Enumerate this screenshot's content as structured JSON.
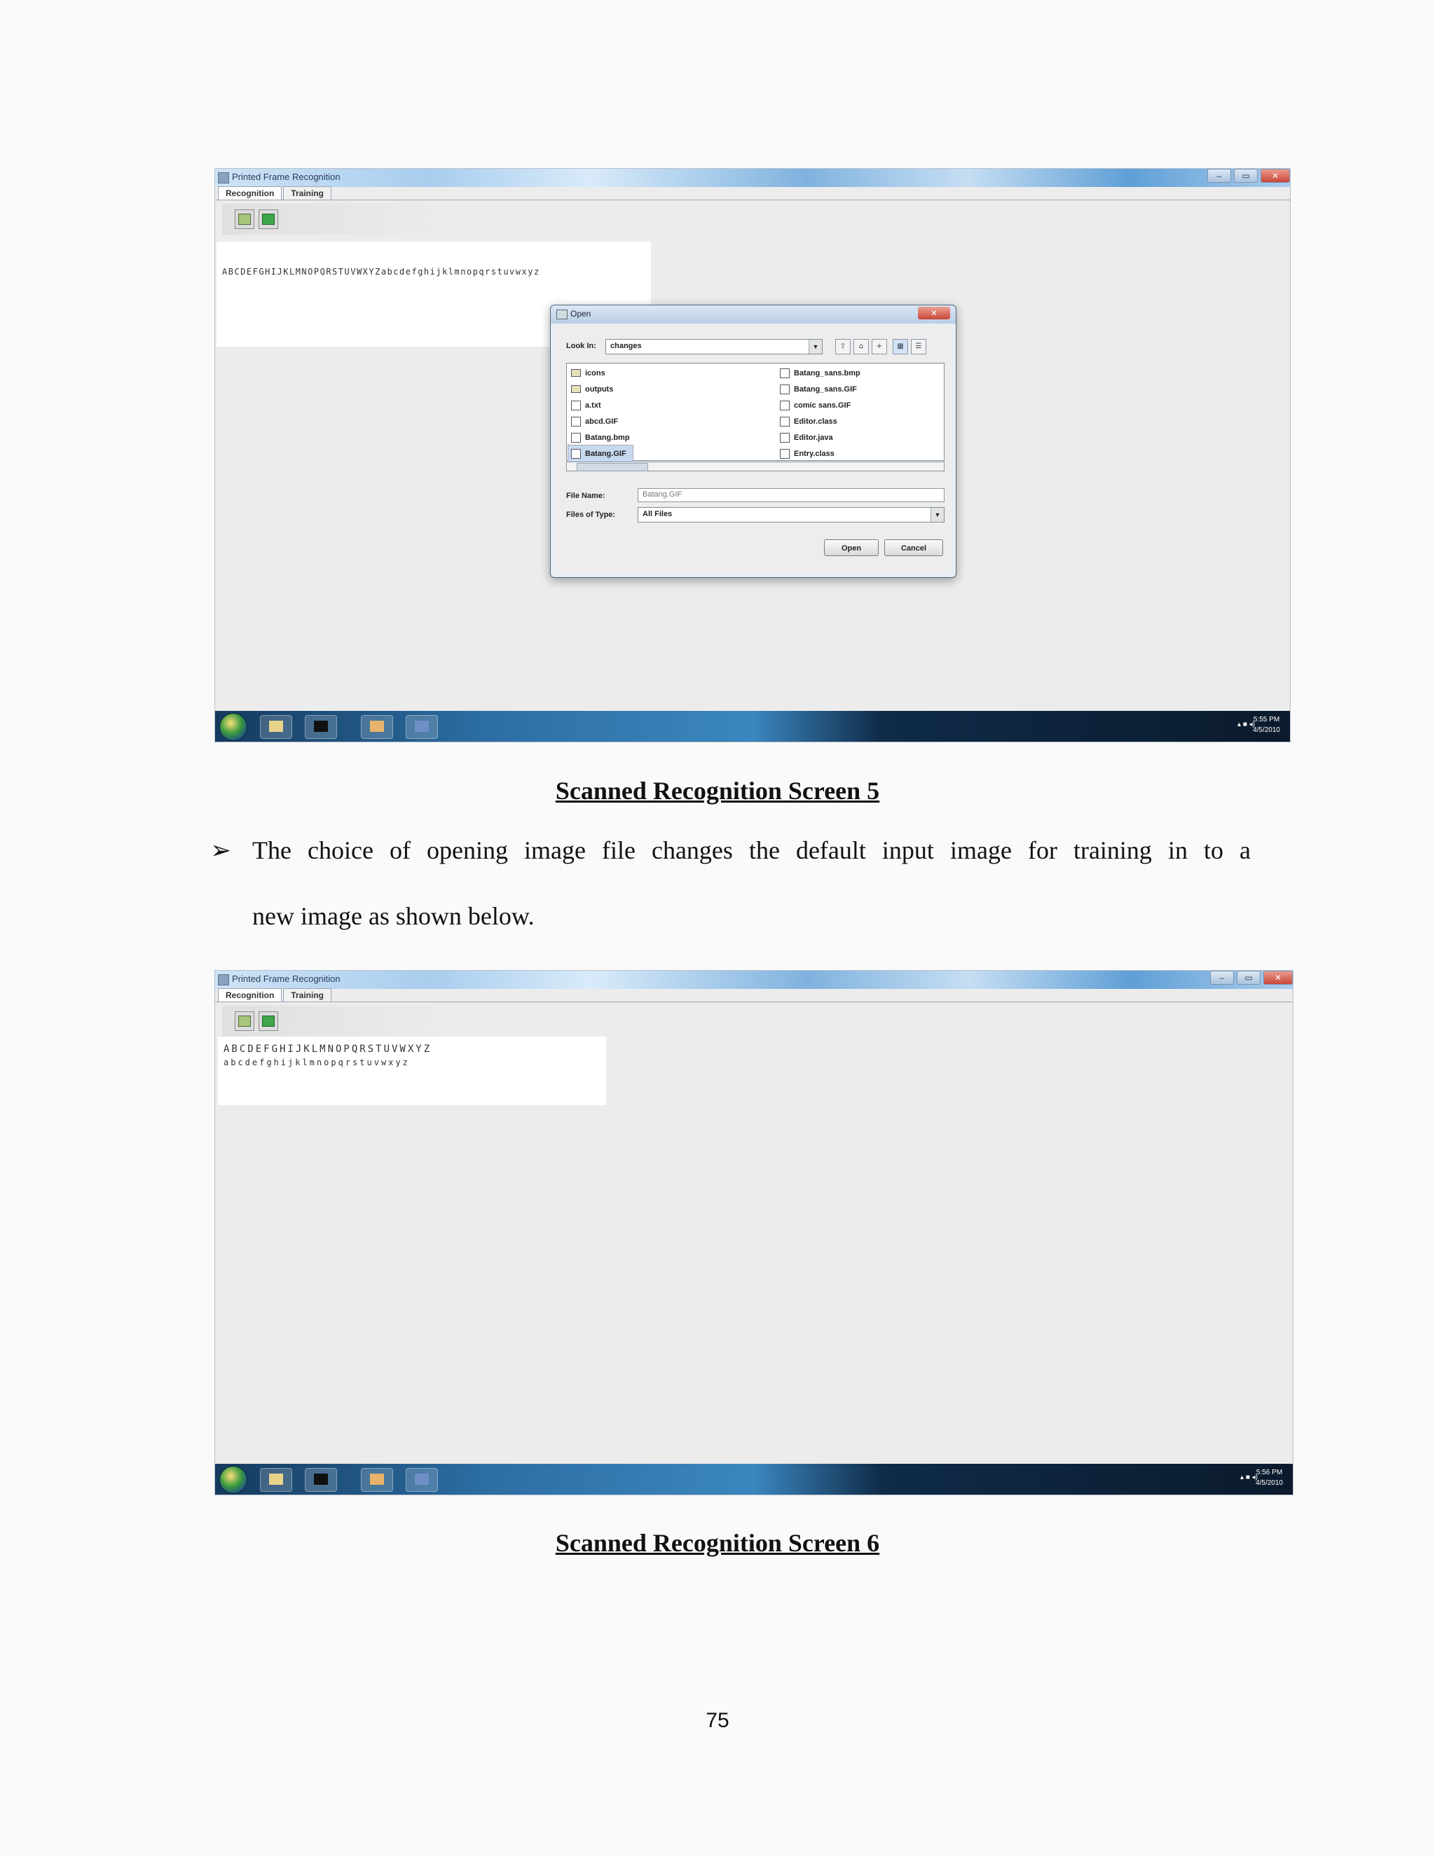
{
  "screen5": {
    "window_title": "Printed Frame Recognition",
    "tabs": [
      "Recognition",
      "Training"
    ],
    "canvas_text": "ABCDEFGHIJKLMNOPQRSTUVWXYZabcdefghijklmnopqrstuvwxyz",
    "dialog": {
      "title": "Open",
      "look_in_label": "Look In:",
      "look_in_value": "changes",
      "files_left": [
        "icons",
        "outputs",
        "a.txt",
        "abcd.GIF",
        "Batang.bmp",
        "Batang.GIF"
      ],
      "files_right": [
        "Batang_sans.bmp",
        "Batang_sans.GIF",
        "comic sans.GIF",
        "Editor.class",
        "Editor.java",
        "Entry.class"
      ],
      "selected_file": "Batang.GIF",
      "file_name_label": "File Name:",
      "file_name_value": "Batang.GIF",
      "files_type_label": "Files of Type:",
      "files_type_value": "All Files",
      "open_label": "Open",
      "cancel_label": "Cancel"
    },
    "clock_time": "5:55 PM",
    "clock_date": "4/5/2010"
  },
  "caption5": "Scanned Recognition Screen 5",
  "bullet_symbol": "➢",
  "paragraph_line1": "The choice of opening image file changes the default input image for training in to a",
  "paragraph_line2": "new image as shown below.",
  "screen6": {
    "window_title": "Printed Frame Recognition",
    "tabs": [
      "Recognition",
      "Training"
    ],
    "canvas_line1": "ABCDEFGHIJKLMNOPQRSTUVWXYZ",
    "canvas_line2": "abcdefghijklmnopqrstuvwxyz",
    "clock_time": "5:56 PM",
    "clock_date": "4/5/2010"
  },
  "caption6": "Scanned Recognition Screen 6",
  "page_number": "75"
}
